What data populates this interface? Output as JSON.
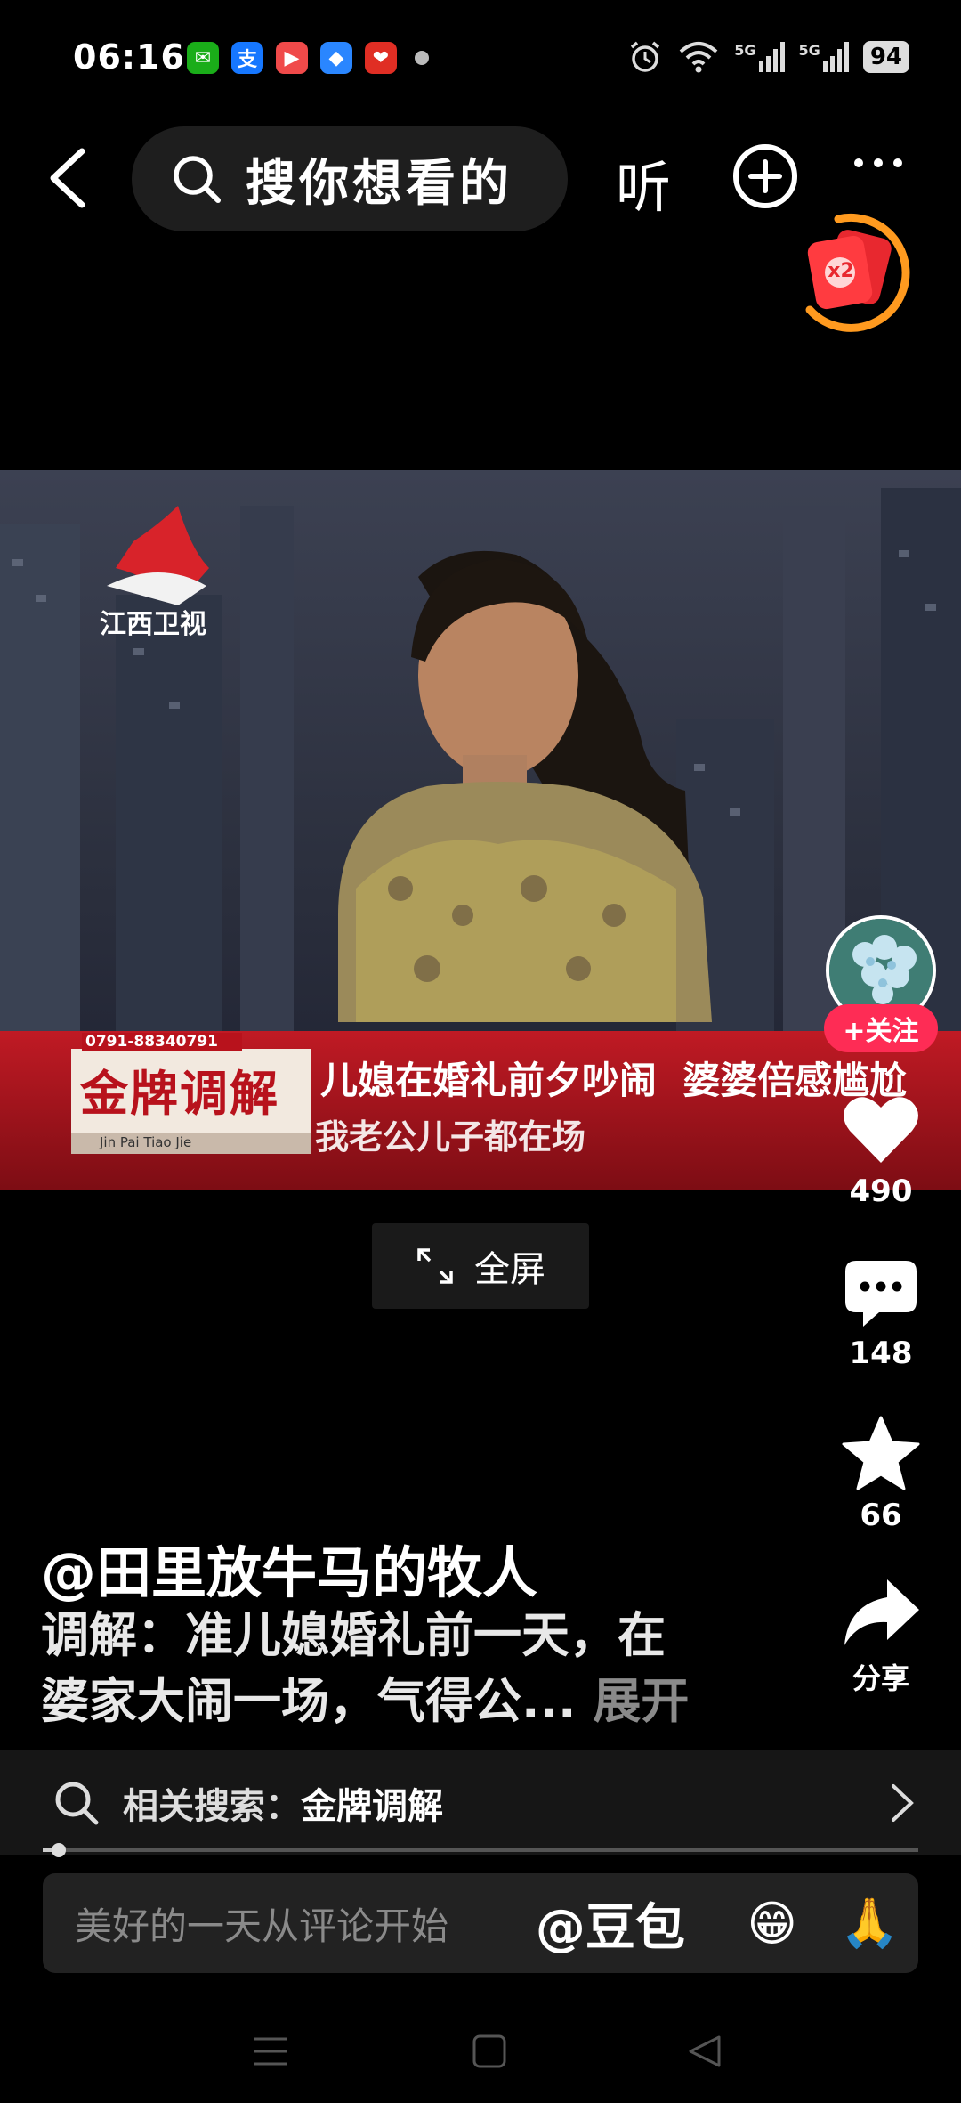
{
  "status_bar": {
    "time": "06:16",
    "notifications": [
      {
        "icon": "wechat-icon",
        "glyph": "✉",
        "color": "#1aad19"
      },
      {
        "icon": "alipay-icon",
        "glyph": "支",
        "color": "#1677ff"
      },
      {
        "icon": "video-app-icon",
        "glyph": "▶",
        "color": "#f04a4a"
      },
      {
        "icon": "browser-app-icon",
        "glyph": "◆",
        "color": "#2a86ff"
      },
      {
        "icon": "pinduoduo-icon",
        "glyph": "❤",
        "color": "#e02e24"
      }
    ],
    "battery": "94",
    "signal_1": "5G",
    "signal_2": "5G"
  },
  "top_nav": {
    "search_placeholder": "搜你想看的",
    "listen_label": "听"
  },
  "red_packet": {
    "badge": "x2"
  },
  "video": {
    "channel_logo": "江西卫视",
    "hotline": "0791-88340791",
    "show_name": "金牌调解",
    "show_pinyin": "Jin Pai   Tiao Jie",
    "headline": "儿媳在婚礼前夕吵闹  婆婆倍感尴尬",
    "subtitle": "我老公儿子都在场"
  },
  "fullscreen_label": "全屏",
  "right_rail": {
    "follow_label": "+关注",
    "likes": "490",
    "comments": "148",
    "favorites": "66",
    "share_label": "分享"
  },
  "caption": {
    "author": "@田里放牛马的牧人",
    "line1": "调解：准儿媳婚礼前一天，在",
    "line2": "婆家大闹一场，气得公...",
    "more": "展开"
  },
  "related_search": {
    "label": "相关搜索：",
    "term": "金牌调解"
  },
  "progress": {
    "fraction": 0.01
  },
  "comment_bar": {
    "placeholder": "美好的一天从评论开始",
    "mention": "@豆包",
    "emoji_1": "😁",
    "emoji_2": "🙏"
  },
  "colors": {
    "accent": "#fe2c55",
    "red_packet_ring": "#ff9a1f"
  }
}
